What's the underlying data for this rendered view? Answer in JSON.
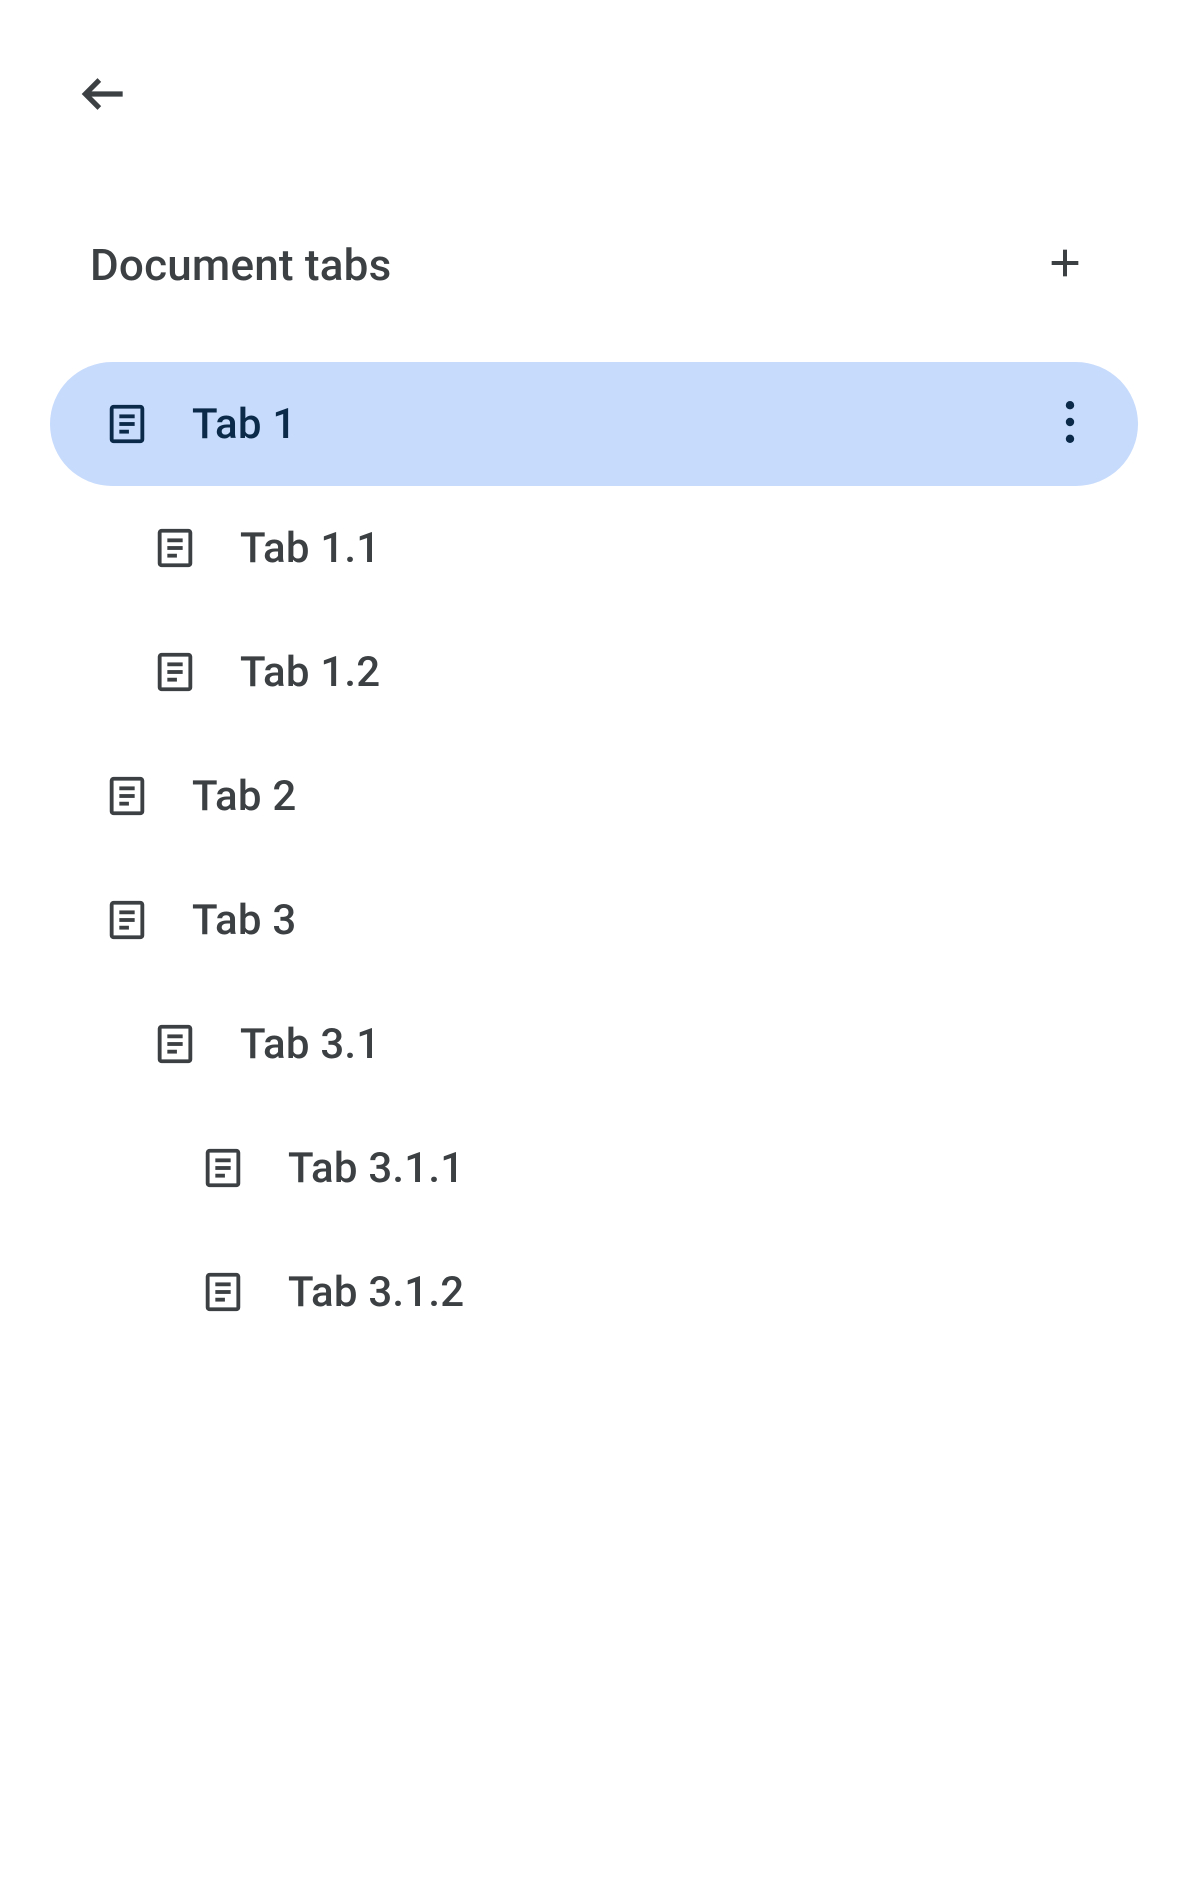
{
  "header": {
    "title": "Document tabs"
  },
  "tabs": [
    {
      "label": "Tab 1",
      "level": 0,
      "selected": true
    },
    {
      "label": "Tab 1.1",
      "level": 1,
      "selected": false
    },
    {
      "label": "Tab 1.2",
      "level": 1,
      "selected": false
    },
    {
      "label": "Tab 2",
      "level": 0,
      "selected": false
    },
    {
      "label": "Tab 3",
      "level": 0,
      "selected": false
    },
    {
      "label": "Tab 3.1",
      "level": 1,
      "selected": false
    },
    {
      "label": "Tab 3.1.1",
      "level": 2,
      "selected": false
    },
    {
      "label": "Tab 3.1.2",
      "level": 2,
      "selected": false
    }
  ]
}
